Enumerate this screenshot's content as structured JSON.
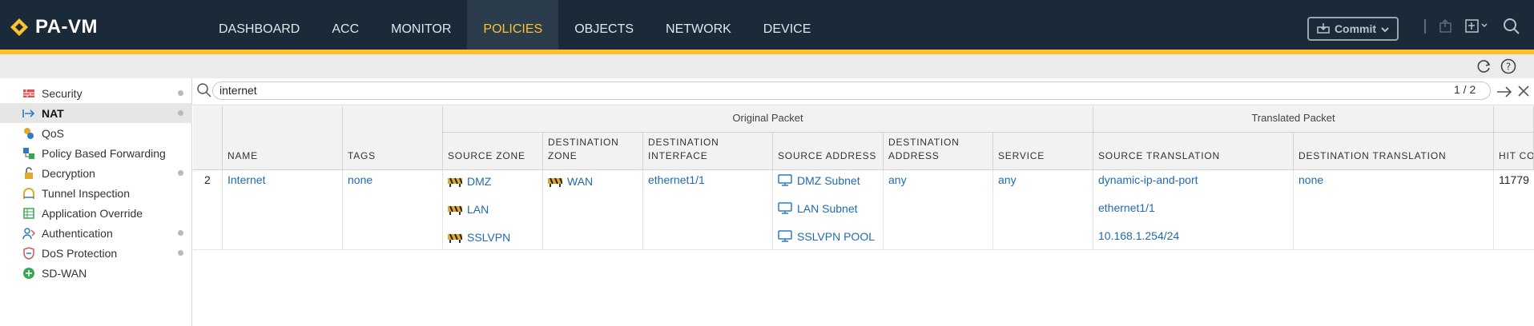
{
  "app": {
    "logo_text": "PA-VM"
  },
  "nav": {
    "tabs": [
      {
        "label": "DASHBOARD"
      },
      {
        "label": "ACC"
      },
      {
        "label": "MONITOR"
      },
      {
        "label": "POLICIES",
        "active": true
      },
      {
        "label": "OBJECTS"
      },
      {
        "label": "NETWORK"
      },
      {
        "label": "DEVICE"
      }
    ],
    "commit_label": "Commit"
  },
  "colors": {
    "topbar": "#1b2a38",
    "accent": "#fcc12c",
    "active_tab": "#2b3c4d",
    "link": "#1f6ab0"
  },
  "sidebar": {
    "items": [
      {
        "label": "Security",
        "icon": "security-icon"
      },
      {
        "label": "NAT",
        "icon": "nat-icon",
        "active": true
      },
      {
        "label": "QoS",
        "icon": "qos-icon"
      },
      {
        "label": "Policy Based Forwarding",
        "icon": "pbf-icon"
      },
      {
        "label": "Decryption",
        "icon": "decryption-icon"
      },
      {
        "label": "Tunnel Inspection",
        "icon": "tunnel-icon"
      },
      {
        "label": "Application Override",
        "icon": "app-override-icon"
      },
      {
        "label": "Authentication",
        "icon": "authentication-icon"
      },
      {
        "label": "DoS Protection",
        "icon": "dos-icon"
      },
      {
        "label": "SD-WAN",
        "icon": "sdwan-icon"
      }
    ]
  },
  "search": {
    "value": "internet",
    "count": "1 / 2"
  },
  "table": {
    "groups": {
      "original": "Original Packet",
      "translated": "Translated Packet"
    },
    "headers": {
      "name": "NAME",
      "tags": "TAGS",
      "source_zone": "SOURCE ZONE",
      "destination_zone": "DESTINATION ZONE",
      "destination_interface": "DESTINATION INTERFACE",
      "source_address": "SOURCE ADDRESS",
      "destination_address": "DESTINATION ADDRESS",
      "service": "SERVICE",
      "source_translation": "SOURCE TRANSLATION",
      "destination_translation": "DESTINATION TRANSLATION",
      "hit_count": "HIT CO"
    },
    "rows": [
      {
        "num": "2",
        "name": "Internet",
        "tags": "none",
        "source_zones": [
          "DMZ",
          "LAN",
          "SSLVPN"
        ],
        "destination_zone": "WAN",
        "destination_interface": "ethernet1/1",
        "source_addresses": [
          "DMZ Subnet",
          "LAN Subnet",
          "SSLVPN POOL"
        ],
        "destination_address": "any",
        "service": "any",
        "source_translation": [
          "dynamic-ip-and-port",
          "ethernet1/1",
          "10.168.1.254/24"
        ],
        "destination_translation": "none",
        "hit_count": "11779"
      }
    ]
  }
}
